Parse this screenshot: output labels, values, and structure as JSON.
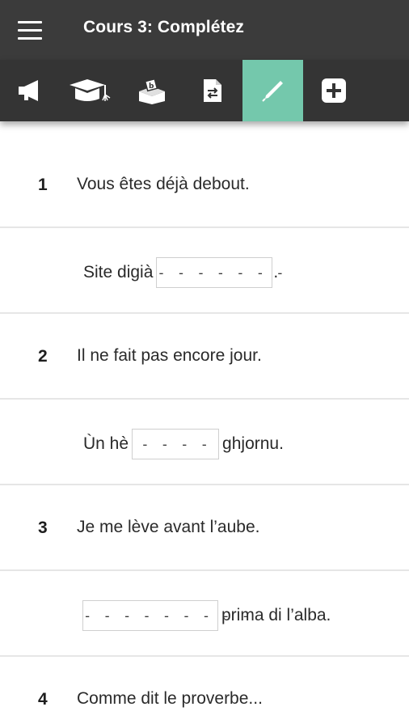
{
  "header": {
    "title": "Cours 3: Complétez"
  },
  "toolbar": {
    "active_color": "#74c8ac",
    "tools": [
      {
        "icon": "megaphone-icon"
      },
      {
        "icon": "graduation-cap-icon"
      },
      {
        "icon": "ballot-box-icon"
      },
      {
        "icon": "document-swap-icon"
      },
      {
        "icon": "pencil-icon",
        "active": true
      },
      {
        "icon": "plus-square-icon"
      }
    ]
  },
  "exercises": [
    {
      "number": "1",
      "french": "Vous êtes déjà debout.",
      "answer_before": "Site digià",
      "blank": "- - - - - - -",
      "answer_after": "."
    },
    {
      "number": "2",
      "french": "Il ne fait pas encore jour.",
      "answer_before": "Ùn hè",
      "blank": "- - - -",
      "answer_after": "ghjornu."
    },
    {
      "number": "3",
      "french": "Je me lève avant l’aube.",
      "answer_before": "",
      "blank": "- - - - - - - - -",
      "answer_after": "prima di l’alba."
    },
    {
      "number": "4",
      "french": "Comme dit le proverbe..."
    }
  ]
}
